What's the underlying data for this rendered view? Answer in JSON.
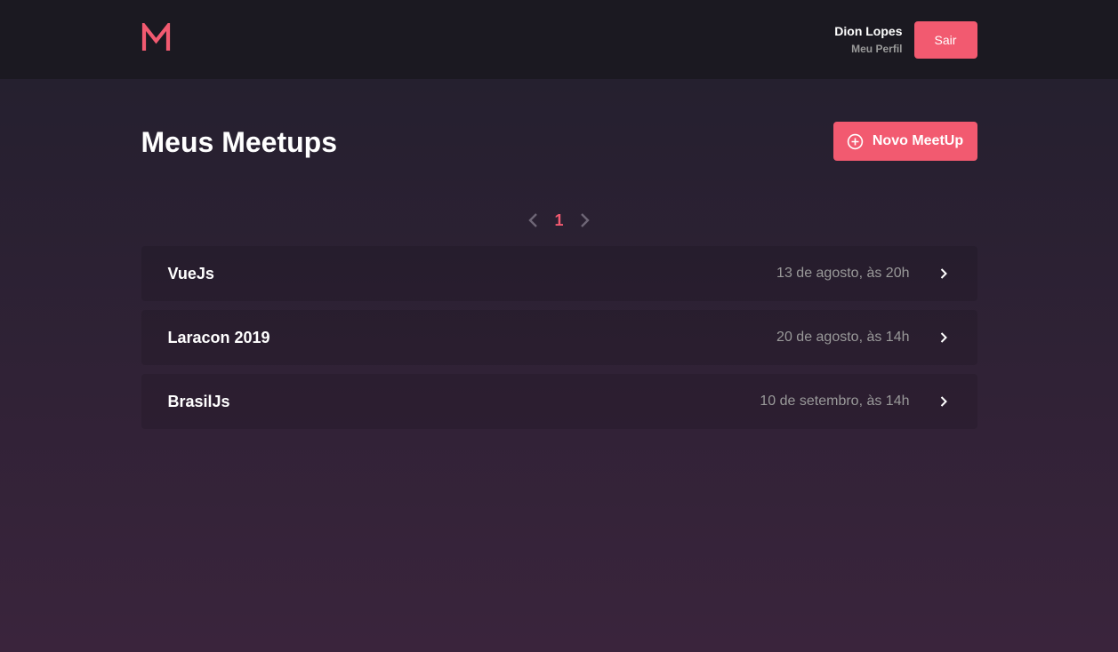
{
  "header": {
    "logo_letter": "M",
    "user_name": "Dion Lopes",
    "profile_link": "Meu Perfil",
    "logout_label": "Sair"
  },
  "main": {
    "title": "Meus Meetups",
    "new_button_label": "Novo MeetUp",
    "pagination": {
      "current_page": "1"
    },
    "meetups": [
      {
        "title": "VueJs",
        "date": "13 de agosto, às 20h"
      },
      {
        "title": "Laracon 2019",
        "date": "20 de agosto, às 14h"
      },
      {
        "title": "BrasilJs",
        "date": "10 de setembro, às 14h"
      }
    ]
  },
  "colors": {
    "accent": "#f25a70",
    "header_bg": "#1b1921",
    "muted_text": "#999999"
  },
  "icons": {
    "logo": "meetapp-logo-icon",
    "new": "plus-circle-icon",
    "prev": "chevron-left-icon",
    "next": "chevron-right-icon",
    "item": "chevron-right-icon"
  }
}
